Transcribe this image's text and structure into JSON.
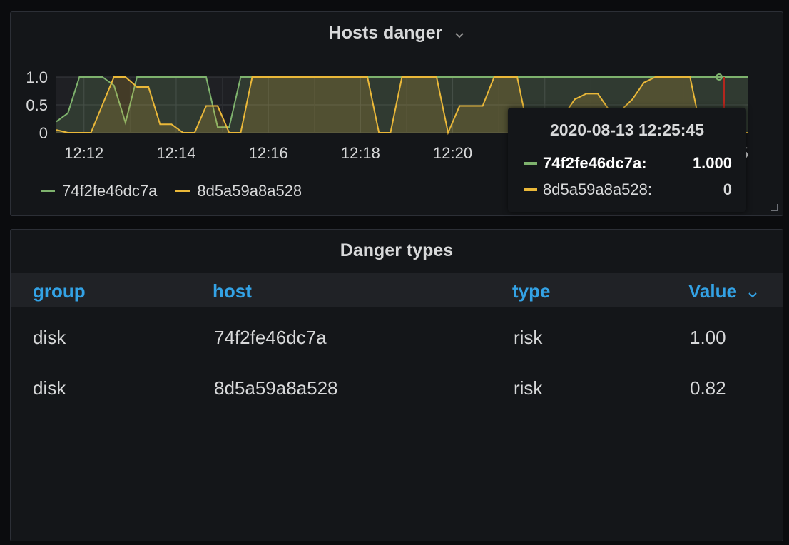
{
  "graph_panel": {
    "title": "Hosts danger",
    "chevron_icon": "chevron-down-icon",
    "legend": [
      {
        "name": "74f2fe46dc7a",
        "color": "#7eb26d"
      },
      {
        "name": "8d5a59a8a528",
        "color": "#eab839"
      }
    ],
    "tooltip": {
      "time": "2020-08-13 12:25:45",
      "rows": [
        {
          "name": "74f2fe46dc7a:",
          "value": "1.000",
          "color": "#7eb26d"
        },
        {
          "name": "8d5a59a8a528:",
          "value": "0",
          "color": "#eab839"
        }
      ]
    },
    "resize_icon": "resize-handle-icon"
  },
  "chart_data": {
    "type": "area",
    "x_labels": [
      "12:12",
      "12:14",
      "12:16",
      "12:18",
      "12:20",
      "5"
    ],
    "y_ticks": [
      "1.0",
      "0.5",
      "0"
    ],
    "ylim": [
      0,
      1
    ],
    "x_minutes": [
      0,
      0.25,
      0.5,
      0.75,
      1.0,
      1.25,
      1.5,
      1.75,
      2.0,
      2.25,
      2.5,
      2.75,
      3.0,
      3.25,
      3.5,
      3.75,
      4.0,
      4.25,
      4.5,
      4.75,
      5.0,
      5.25,
      5.5,
      5.75,
      6.0,
      6.25,
      6.5,
      6.75,
      7.0,
      7.25,
      7.5,
      7.75,
      8.0,
      8.25,
      8.5,
      8.75,
      9.0,
      9.25,
      9.5,
      9.75,
      10.0,
      10.25,
      10.5,
      10.75,
      11.0,
      11.25,
      11.5,
      11.75,
      12.0,
      12.25,
      12.5,
      12.75,
      13.0,
      13.25,
      13.5,
      13.75,
      14.0,
      14.25,
      14.5,
      14.75,
      15.0
    ],
    "series": [
      {
        "name": "74f2fe46dc7a",
        "color": "#7eb26d",
        "values": [
          0.2,
          0.35,
          1,
          1,
          1,
          0.85,
          0.18,
          1,
          1,
          1,
          1,
          1,
          1,
          1,
          0.1,
          0.1,
          1,
          1,
          1,
          1,
          1,
          1,
          1,
          1,
          1,
          1,
          1,
          1,
          1,
          1,
          1,
          1,
          1,
          1,
          1,
          1,
          1,
          1,
          1,
          1,
          1,
          1,
          1,
          1,
          1,
          1,
          1,
          1,
          1,
          1,
          1,
          1,
          1,
          1,
          1,
          1,
          1,
          1,
          1,
          1,
          1
        ]
      },
      {
        "name": "8d5a59a8a528",
        "color": "#eab839",
        "values": [
          0.05,
          0,
          0,
          0,
          0.5,
          1,
          1,
          0.82,
          0.82,
          0.15,
          0.15,
          0,
          0,
          0.48,
          0.48,
          0,
          0,
          1,
          1,
          1,
          1,
          1,
          1,
          1,
          1,
          1,
          1,
          1,
          0,
          0,
          1,
          1,
          1,
          1,
          0,
          0.48,
          0.48,
          0.48,
          1,
          1,
          1,
          0,
          0,
          0.3,
          0.3,
          0.6,
          0.7,
          0.7,
          0.4,
          0.4,
          0.6,
          0.9,
          1,
          1,
          1,
          1,
          0,
          0,
          0,
          0,
          0
        ]
      }
    ],
    "grid": true
  },
  "table_panel": {
    "title": "Danger types",
    "columns": [
      "group",
      "host",
      "type",
      "Value"
    ],
    "sort_icon": "chevron-down-icon",
    "rows": [
      {
        "group": "disk",
        "host": "74f2fe46dc7a",
        "type": "risk",
        "value": "1.00"
      },
      {
        "group": "disk",
        "host": "8d5a59a8a528",
        "type": "risk",
        "value": "0.82"
      }
    ]
  }
}
